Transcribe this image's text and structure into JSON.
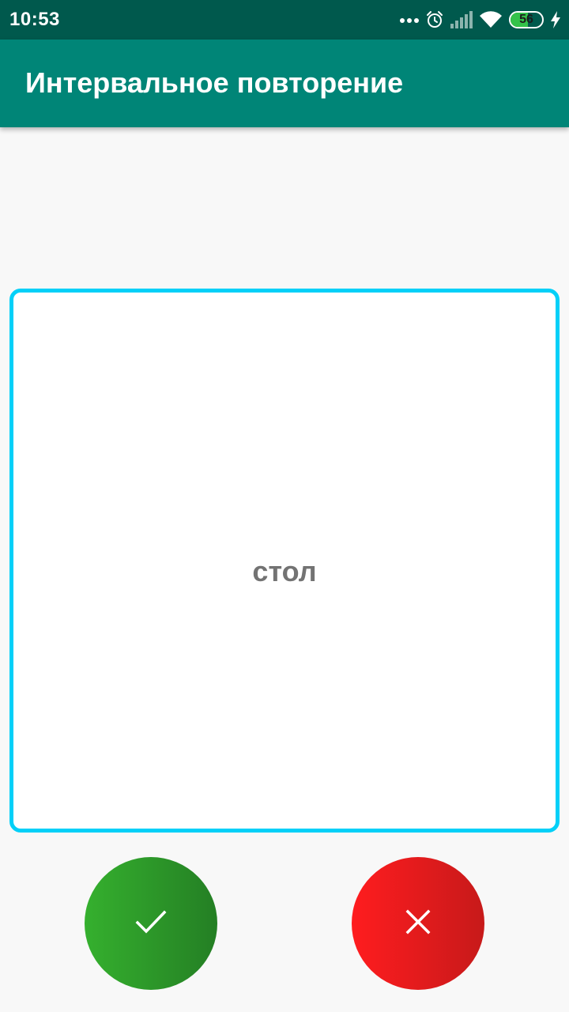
{
  "status_bar": {
    "time": "10:53",
    "battery_level": "56",
    "battery_fraction": 0.56,
    "icons": [
      "more-dots-icon",
      "alarm-clock-icon",
      "signal-icon",
      "wifi-icon",
      "battery-icon",
      "charging-bolt-icon"
    ]
  },
  "app_bar": {
    "title": "Интервальное повторение"
  },
  "flashcard": {
    "word": "стол"
  },
  "actions": {
    "know_icon": "checkmark-icon",
    "dont_know_icon": "close-icon"
  },
  "colors": {
    "status_bar": "#00594d",
    "app_bar": "#008577",
    "card_border": "#03d0f8",
    "know_button": "#2e9c29",
    "dont_know_button": "#ee1b1d",
    "battery_fill": "#34c24a"
  }
}
